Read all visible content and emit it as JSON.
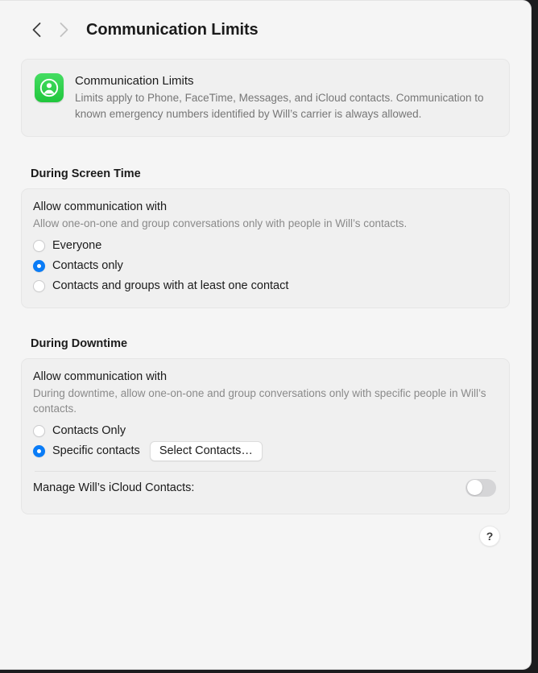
{
  "window": {
    "nav": {
      "back_icon": "chevron-left-icon",
      "forward_icon": "chevron-right-icon"
    },
    "title": "Communication Limits"
  },
  "intro": {
    "icon": "communication-limits-icon",
    "icon_color": "#22c63e",
    "title": "Communication Limits",
    "description": "Limits apply to Phone, FaceTime, Messages, and iCloud contacts. Communication to known emergency numbers identified by Will’s carrier is always allowed."
  },
  "screen_time": {
    "section_title": "During Screen Time",
    "field_label": "Allow communication with",
    "field_help": "Allow one-on-one and group conversations only with people in Will’s contacts.",
    "options": [
      {
        "label": "Everyone",
        "selected": false
      },
      {
        "label": "Contacts only",
        "selected": true
      },
      {
        "label": "Contacts and groups with at least one contact",
        "selected": false
      }
    ]
  },
  "downtime": {
    "section_title": "During Downtime",
    "field_label": "Allow communication with",
    "field_help": "During downtime, allow one-on-one and group conversations only with specific people in Will’s contacts.",
    "options": [
      {
        "label": "Contacts Only",
        "selected": false
      },
      {
        "label": "Specific contacts",
        "selected": true
      }
    ],
    "select_contacts_button": "Select Contacts…",
    "manage_label": "Manage Will’s iCloud Contacts:",
    "manage_toggle_on": false
  },
  "help": {
    "label": "?"
  },
  "colors": {
    "accent": "#0a7cf7",
    "page_background": "#f5f5f5",
    "card_background": "#f0f0f0"
  }
}
